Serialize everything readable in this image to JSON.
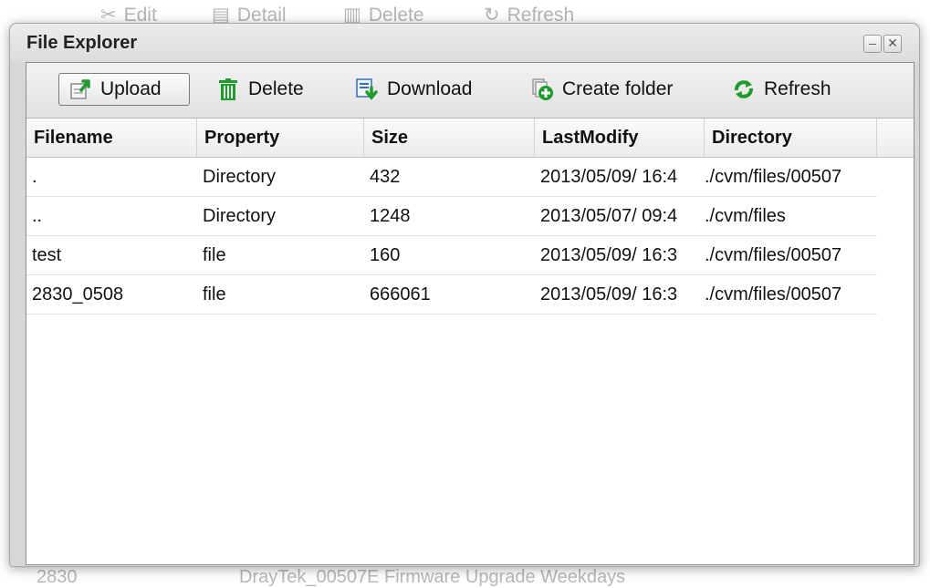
{
  "background": {
    "toolbar": [
      {
        "label": "Edit",
        "icon": "edit-icon"
      },
      {
        "label": "Detail",
        "icon": "detail-icon"
      },
      {
        "label": "Delete",
        "icon": "trash-icon"
      },
      {
        "label": "Refresh",
        "icon": "refresh-icon"
      }
    ],
    "footer": {
      "id": "2830",
      "desc": "DrayTek_00507E Firmware Upgrade Weekdays"
    }
  },
  "window": {
    "title": "File Explorer",
    "minimize_symbol": "–",
    "close_symbol": "✕"
  },
  "toolbar": {
    "upload": "Upload",
    "delete": "Delete",
    "download": "Download",
    "create_folder": "Create folder",
    "refresh": "Refresh"
  },
  "table": {
    "columns": [
      "Filename",
      "Property",
      "Size",
      "LastModify",
      "Directory"
    ],
    "rows": [
      {
        "filename": ".",
        "property": "Directory",
        "size": "432",
        "modified": "2013/05/09/ 16:4",
        "directory": "./cvm/files/00507"
      },
      {
        "filename": "..",
        "property": "Directory",
        "size": "1248",
        "modified": "2013/05/07/ 09:4",
        "directory": "./cvm/files"
      },
      {
        "filename": "test",
        "property": "file",
        "size": "160",
        "modified": "2013/05/09/ 16:3",
        "directory": "./cvm/files/00507"
      },
      {
        "filename": "2830_0508",
        "property": "file",
        "size": "666061",
        "modified": "2013/05/09/ 16:3",
        "directory": "./cvm/files/00507"
      }
    ]
  },
  "colors": {
    "icon_green": "#1e9b2c",
    "icon_blue": "#2f6fb6",
    "icon_orange": "#e8a52d"
  }
}
